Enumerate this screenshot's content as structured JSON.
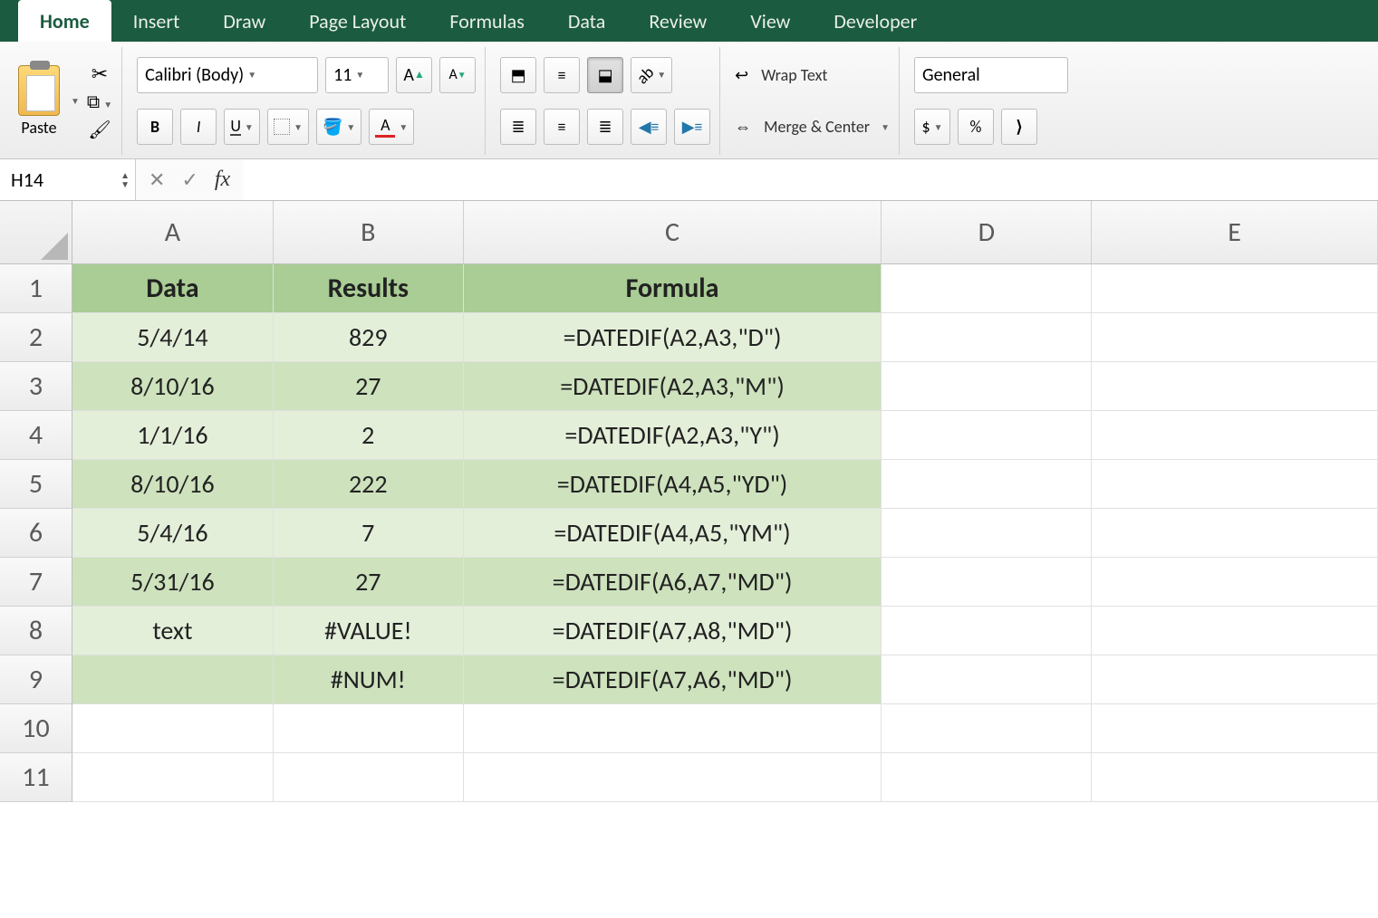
{
  "tabs": [
    "Home",
    "Insert",
    "Draw",
    "Page Layout",
    "Formulas",
    "Data",
    "Review",
    "View",
    "Developer"
  ],
  "active_tab": 0,
  "ribbon": {
    "paste_label": "Paste",
    "font_name": "Calibri (Body)",
    "font_size": "11",
    "bold": "B",
    "italic": "I",
    "underline": "U",
    "wrap_text": "Wrap Text",
    "merge_center": "Merge & Center",
    "number_format": "General",
    "currency": "$",
    "percent": "%"
  },
  "name_box": "H14",
  "formula_value": "",
  "columns": [
    "A",
    "B",
    "C",
    "D",
    "E"
  ],
  "col_classes": [
    "wA",
    "wB",
    "wC",
    "wD",
    "wE"
  ],
  "row_numbers": [
    "1",
    "2",
    "3",
    "4",
    "5",
    "6",
    "7",
    "8",
    "9",
    "10",
    "11"
  ],
  "table": {
    "headers": [
      "Data",
      "Results",
      "Formula"
    ],
    "rows": [
      {
        "data": "5/4/14",
        "results": "829",
        "formula": "=DATEDIF(A2,A3,\"D\")"
      },
      {
        "data": "8/10/16",
        "results": "27",
        "formula": "=DATEDIF(A2,A3,\"M\")"
      },
      {
        "data": "1/1/16",
        "results": "2",
        "formula": "=DATEDIF(A2,A3,\"Y\")"
      },
      {
        "data": "8/10/16",
        "results": "222",
        "formula": "=DATEDIF(A4,A5,\"YD\")"
      },
      {
        "data": "5/4/16",
        "results": "7",
        "formula": "=DATEDIF(A4,A5,\"YM\")"
      },
      {
        "data": "5/31/16",
        "results": "27",
        "formula": "=DATEDIF(A6,A7,\"MD\")"
      },
      {
        "data": "text",
        "results": "#VALUE!",
        "formula": "=DATEDIF(A7,A8,\"MD\")"
      },
      {
        "data": "",
        "results": "#NUM!",
        "formula": "=DATEDIF(A7,A6,\"MD\")"
      }
    ]
  }
}
